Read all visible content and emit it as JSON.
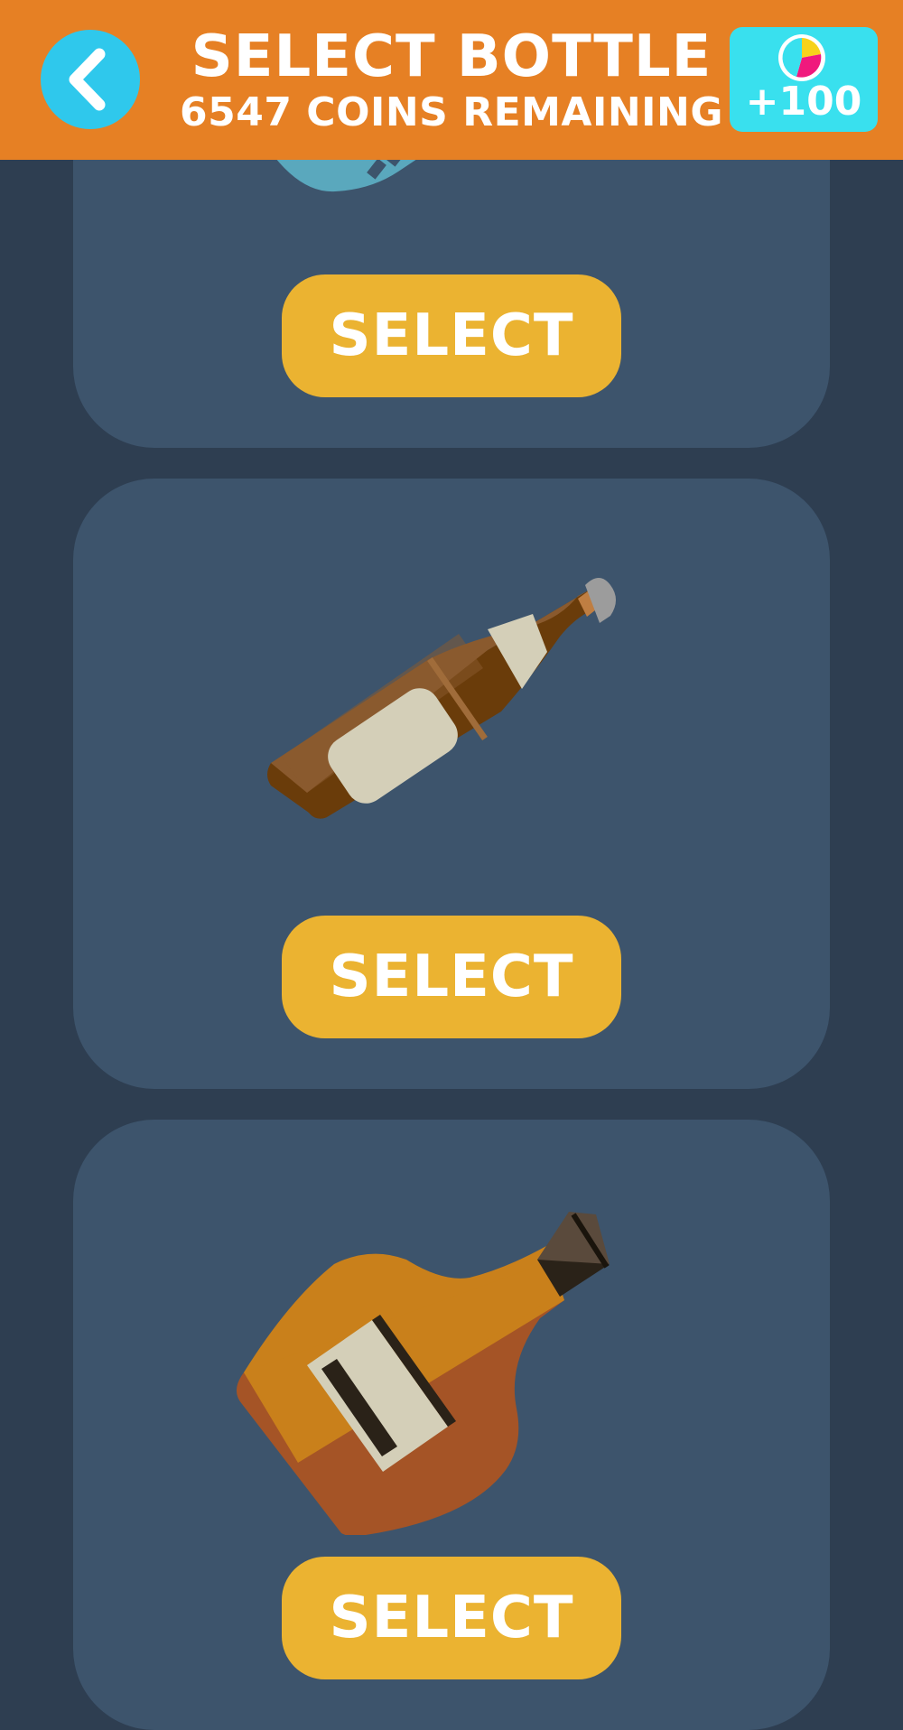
{
  "header": {
    "title": "SELECT BOTTLE",
    "subtitle": "6547 COINS REMAINING",
    "back_icon": "chevron-left-icon",
    "bonus_icon": "pie-chart-icon",
    "bonus_label": "+100"
  },
  "bottles": [
    {
      "name": "blue bottle",
      "select_label": "SELECT"
    },
    {
      "name": "brown beer bottle",
      "select_label": "SELECT"
    },
    {
      "name": "cognac bottle",
      "select_label": "SELECT"
    }
  ],
  "colors": {
    "header": "#e68024",
    "back_button": "#2fc8ec",
    "bonus_button": "#39e0ee",
    "background": "#2e3e51",
    "card": "#3d546c",
    "select_button": "#ebb331"
  }
}
